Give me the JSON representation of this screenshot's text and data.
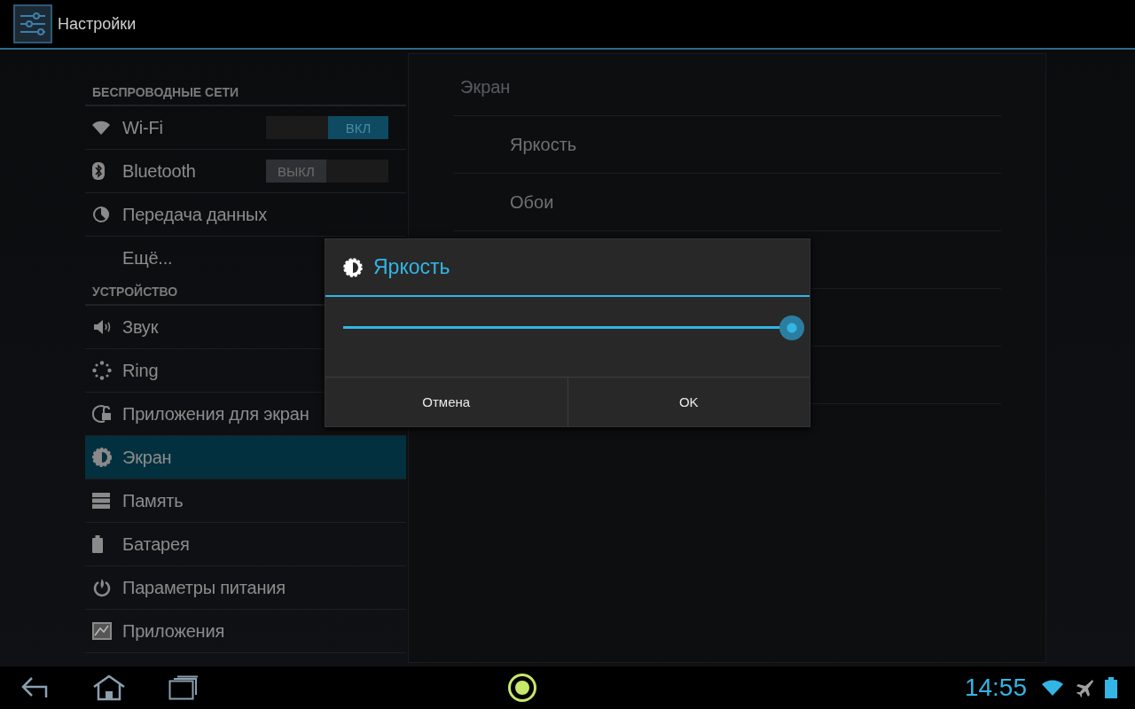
{
  "action_bar": {
    "title": "Настройки"
  },
  "sidebar": {
    "items": [
      {
        "kind": "header",
        "label": "БЕСПРОВОДНЫЕ СЕТИ"
      },
      {
        "kind": "toggle",
        "label": "Wi-Fi",
        "on": true,
        "toggle_label": "ВКЛ",
        "selected": false
      },
      {
        "kind": "toggle",
        "label": "Bluetooth",
        "on": false,
        "toggle_label": "ВЫКЛ",
        "selected": false
      },
      {
        "kind": "item",
        "label": "Передача данных",
        "selected": false
      },
      {
        "kind": "item",
        "label": "Ещё...",
        "selected": false
      },
      {
        "kind": "header",
        "label": "УСТРОЙСТВО"
      },
      {
        "kind": "item",
        "label": "Звук",
        "selected": false
      },
      {
        "kind": "item",
        "label": "Ring",
        "selected": false
      },
      {
        "kind": "item",
        "label": "Приложения для экран",
        "selected": false
      },
      {
        "kind": "item",
        "label": "Экран",
        "selected": true
      },
      {
        "kind": "item",
        "label": "Память",
        "selected": false
      },
      {
        "kind": "item",
        "label": "Батарея",
        "selected": false
      },
      {
        "kind": "item",
        "label": "Параметры питания",
        "selected": false
      },
      {
        "kind": "item",
        "label": "Приложения",
        "selected": false
      }
    ]
  },
  "content": {
    "title": "Экран",
    "items": [
      "Яркость",
      "Обои"
    ]
  },
  "dialog": {
    "title": "Яркость",
    "level": 1,
    "buttons": [
      "Отмена",
      "OK"
    ]
  },
  "nav_bar": {
    "time": "14:55"
  }
}
